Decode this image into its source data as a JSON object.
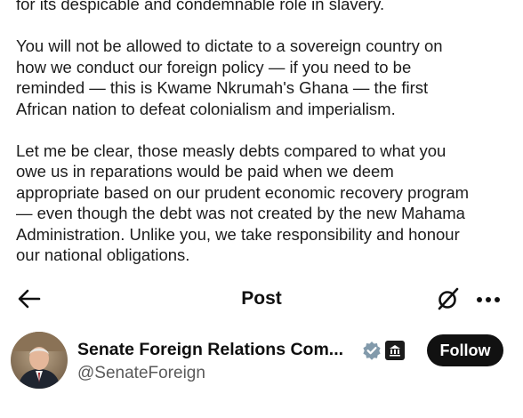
{
  "post_text": {
    "line_0": "for its despicable and condemnable role in slavery.",
    "paragraph_1": [
      "You will not be allowed to dictate to a sovereign country on",
      "how we conduct our foreign policy — if you need to be",
      "reminded — this is Kwame Nkrumah's Ghana — the first",
      "African nation to defeat colonialism and imperialism."
    ],
    "paragraph_2": [
      "Let me be clear, those measly debts compared to what you",
      "owe us in reparations would be paid when we deem",
      "appropriate based on our prudent economic recovery program",
      "— even though the debt was not created by the new Mahama",
      "Administration. Unlike you, we take responsibility and honour",
      "our national obligations."
    ]
  },
  "topbar": {
    "back_icon": "arrow-left-icon",
    "title": "Post",
    "grok_icon": "slashed-circle-icon",
    "more_icon": "more-horizontal-icon"
  },
  "author": {
    "display_name": "Senate Foreign Relations Com...",
    "handle": "@SenateForeign",
    "verified_icon": "verified-badge-icon",
    "gov_icon": "government-badge-icon",
    "follow_label": "Follow"
  },
  "colors": {
    "text": "#1c1c1c",
    "secondary_text": "#5a5a5a",
    "follow_bg": "#111111",
    "verified_badge": "#829aab"
  }
}
